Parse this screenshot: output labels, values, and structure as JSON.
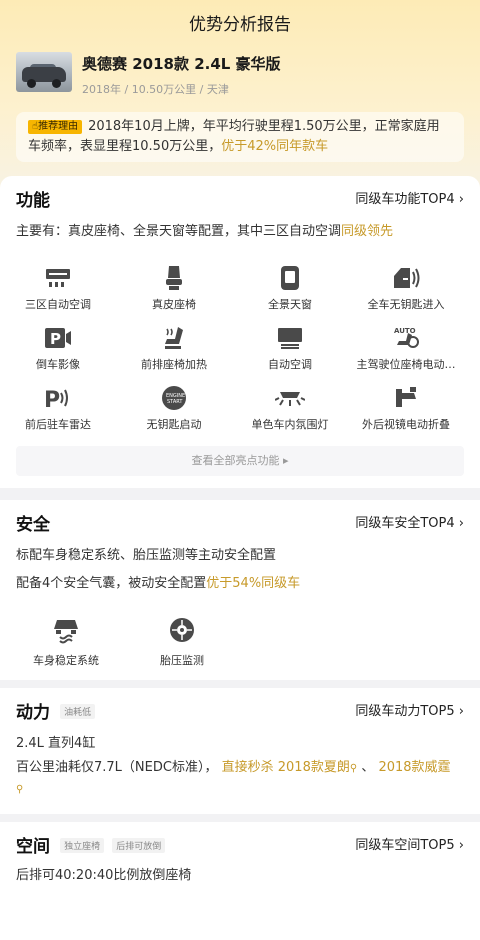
{
  "page_title": "优势分析报告",
  "car": {
    "name": "奥德赛 2018款 2.4L 豪华版",
    "meta": "2018年 / 10.50万公里 / 天津"
  },
  "reason": {
    "tag": "推荐理由",
    "text": "2018年10月上牌，年平均行驶里程1.50万公里，正常家庭用车频率，表显里程10.50万公里，",
    "highlight": "优于42%同年款车"
  },
  "function": {
    "title": "功能",
    "rank": "同级车功能TOP4",
    "desc": "主要有：真皮座椅、全景天窗等配置，其中三区自动空调",
    "desc_highlight": "同级领先",
    "items": [
      {
        "label": "三区自动空调",
        "icon": "climate-control-icon"
      },
      {
        "label": "真皮座椅",
        "icon": "leather-seat-icon"
      },
      {
        "label": "全景天窗",
        "icon": "panoramic-sunroof-icon"
      },
      {
        "label": "全车无钥匙进入",
        "icon": "keyless-entry-icon"
      },
      {
        "label": "倒车影像",
        "icon": "parking-camera-icon"
      },
      {
        "label": "前排座椅加热",
        "icon": "seat-heating-icon"
      },
      {
        "label": "自动空调",
        "icon": "auto-ac-icon"
      },
      {
        "label": "主驾驶位座椅电动…",
        "icon": "power-seat-icon"
      },
      {
        "label": "前后驻车雷达",
        "icon": "parking-radar-icon"
      },
      {
        "label": "无钥匙启动",
        "icon": "start-button-icon"
      },
      {
        "label": "单色车内氛围灯",
        "icon": "ambient-light-icon"
      },
      {
        "label": "外后视镜电动折叠",
        "icon": "mirror-fold-icon"
      }
    ],
    "more": "查看全部亮点功能 ▸"
  },
  "safety": {
    "title": "安全",
    "rank": "同级车安全TOP4",
    "desc1": "标配车身稳定系统、胎压监测等主动安全配置",
    "desc2": "配备4个安全气囊，被动安全配置",
    "desc2_highlight": "优于54%同级车",
    "items": [
      {
        "label": "车身稳定系统",
        "icon": "stability-control-icon"
      },
      {
        "label": "胎压监测",
        "icon": "tire-pressure-icon"
      }
    ]
  },
  "power": {
    "title": "动力",
    "pill": "油耗低",
    "rank": "同级车动力TOP5",
    "engine": "2.4L 直列4缸",
    "consumption": "百公里油耗仅7.7L（NEDC标准），",
    "kill": "直接秒杀",
    "rival1": "2018款夏朗",
    "sep": "、",
    "rival2": "2018款威霆"
  },
  "space": {
    "title": "空间",
    "pills": [
      "独立座椅",
      "后排可放倒"
    ],
    "rank": "同级车空间TOP5",
    "desc": "后排可40:20:40比例放倒座椅"
  },
  "colors": {
    "accent": "#c79a2a",
    "tag": "#f7b500",
    "icon": "#4a4a4a"
  }
}
